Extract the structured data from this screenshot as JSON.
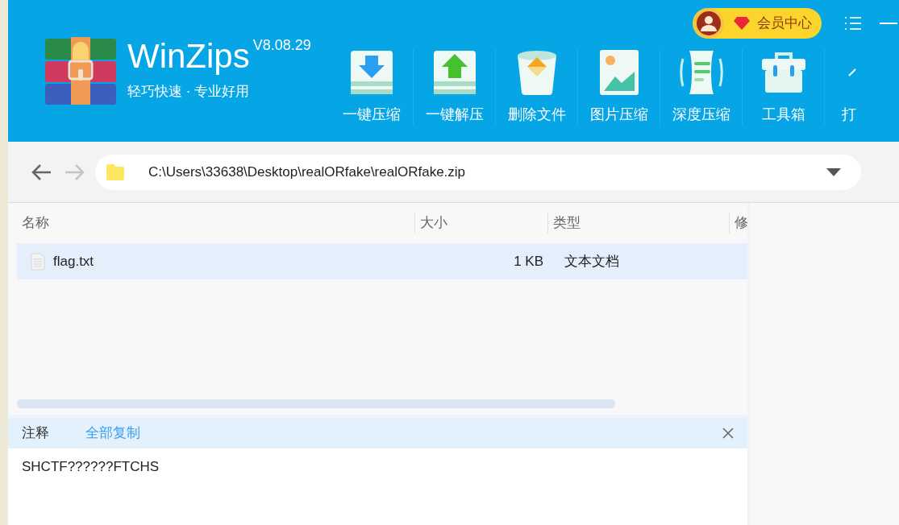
{
  "app": {
    "name": "WinZips",
    "version": "V8.08.29",
    "tagline": "轻巧快速 · 专业好用"
  },
  "member_button": {
    "label": "会员中心"
  },
  "toolbar": [
    {
      "label": "一键压缩",
      "kind": "compress"
    },
    {
      "label": "一键解压",
      "kind": "extract"
    },
    {
      "label": "删除文件",
      "kind": "delete"
    },
    {
      "label": "图片压缩",
      "kind": "image"
    },
    {
      "label": "深度压缩",
      "kind": "deep"
    },
    {
      "label": "工具箱",
      "kind": "toolbox"
    },
    {
      "label": "打",
      "kind": "open"
    }
  ],
  "address_bar": {
    "path": "C:\\Users\\33638\\Desktop\\realORfake\\realORfake.zip"
  },
  "file_list": {
    "columns": [
      "名称",
      "大小",
      "类型",
      "修"
    ],
    "rows": [
      {
        "name": "flag.txt",
        "size": "1 KB",
        "type": "文本文档",
        "selected": true
      }
    ]
  },
  "comment": {
    "title": "注释",
    "copy_label": "全部复制",
    "text": "SHCTF??????FTCHS"
  }
}
